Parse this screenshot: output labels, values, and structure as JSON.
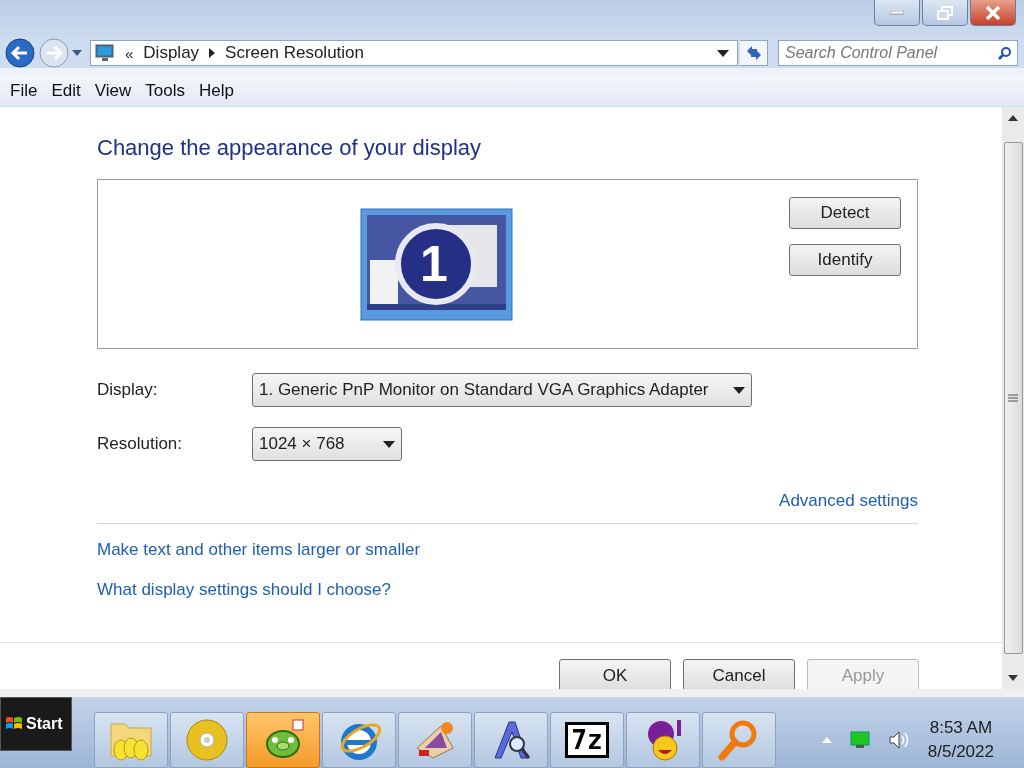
{
  "window": {
    "controls": [
      {
        "kind": "minimize"
      },
      {
        "kind": "maximize"
      },
      {
        "kind": "close"
      }
    ]
  },
  "address_bar": {
    "prefix": "«",
    "crumbs": [
      "Display",
      "Screen Resolution"
    ],
    "search_placeholder": "Search Control Panel"
  },
  "menu": [
    "File",
    "Edit",
    "View",
    "Tools",
    "Help"
  ],
  "heading": "Change the appearance of your display",
  "preview": {
    "monitor_number": "1",
    "buttons": [
      "Detect",
      "Identify"
    ]
  },
  "settings": [
    {
      "label": "Display:",
      "value": "1. Generic PnP Monitor on Standard VGA Graphics Adapter",
      "kind": "wide"
    },
    {
      "label": "Resolution:",
      "value": "1024 × 768",
      "kind": "narrow"
    }
  ],
  "advanced_link": "Advanced settings",
  "links": [
    "Make text and other items larger or smaller",
    "What display settings should I choose?"
  ],
  "buttons": [
    {
      "label": "OK",
      "disabled": false
    },
    {
      "label": "Cancel",
      "disabled": false
    },
    {
      "label": "Apply",
      "disabled": true
    }
  ],
  "taskbar": {
    "start": "Start",
    "apps": [
      {
        "kind": "folder",
        "selected": false
      },
      {
        "kind": "disc",
        "selected": false
      },
      {
        "kind": "pig",
        "selected": true
      },
      {
        "kind": "browser",
        "selected": false
      },
      {
        "kind": "paint",
        "selected": false
      },
      {
        "kind": "font",
        "selected": false
      },
      {
        "kind": "sevenzip",
        "label": "7z",
        "selected": false
      },
      {
        "kind": "messenger",
        "selected": false
      },
      {
        "kind": "search",
        "selected": false
      }
    ],
    "time": "8:53 AM",
    "date": "8/5/2022"
  }
}
